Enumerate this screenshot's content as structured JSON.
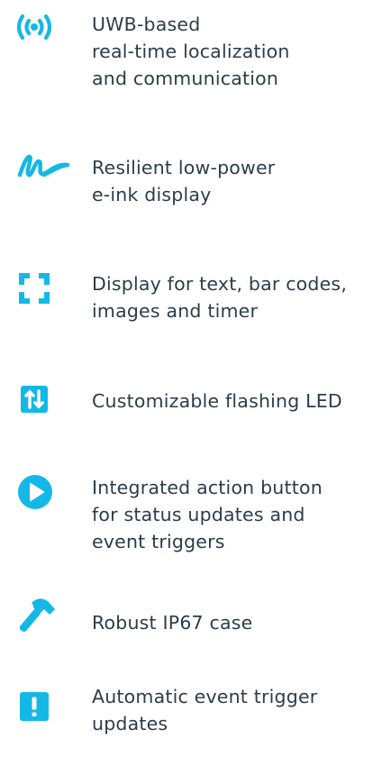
{
  "accent_color": "#14b8e6",
  "text_color": "#2b3d4a",
  "features": [
    {
      "icon": "broadcast-icon",
      "text": "UWB-based\nreal-time localization\nand communication"
    },
    {
      "icon": "ink-signature-icon",
      "text": "Resilient low-power\ne-ink display"
    },
    {
      "icon": "frame-corners-icon",
      "text": "Display for text, bar codes,\nimages and timer"
    },
    {
      "icon": "sliders-toggle-icon",
      "text": "Customizable flashing LED"
    },
    {
      "icon": "play-circle-icon",
      "text": "Integrated action button\nfor status updates and\nevent triggers"
    },
    {
      "icon": "hammer-icon",
      "text": "Robust IP67 case"
    },
    {
      "icon": "exclamation-square-icon",
      "text": "Automatic event trigger\nupdates"
    }
  ]
}
